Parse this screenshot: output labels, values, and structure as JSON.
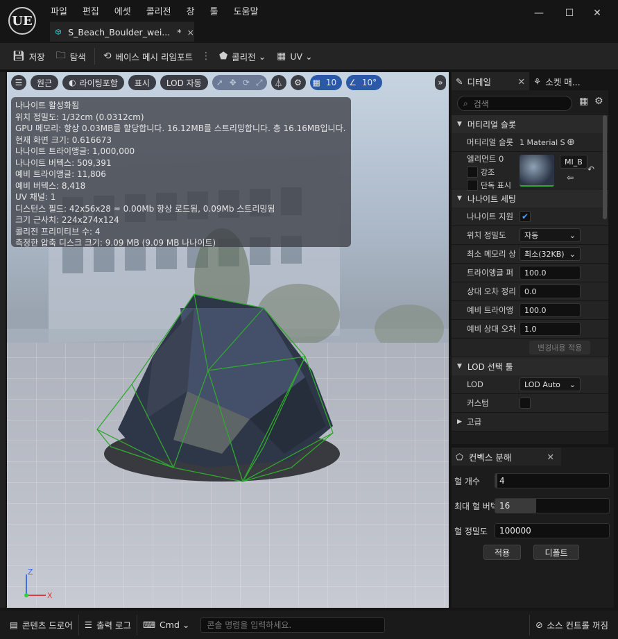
{
  "app": {
    "logo": "UE",
    "menu": [
      "파일",
      "편집",
      "에셋",
      "콜리전",
      "창",
      "툴",
      "도움말"
    ],
    "window_controls": [
      "minimize-icon",
      "maximize-icon",
      "close-icon"
    ]
  },
  "doc_tab": {
    "title": "S_Beach_Boulder_wei...",
    "dirty": "*",
    "close": "×"
  },
  "toolbar": {
    "save": "저장",
    "browse": "탐색",
    "reimport": "베이스 메시 리임포트",
    "collision": "콜리전",
    "uv": "UV"
  },
  "viewport": {
    "tools": {
      "perspective": "원근",
      "lighting": "라이팅포함",
      "show": "표시",
      "lod": "LOD 자동",
      "grid_snap": "10",
      "rot_snap": "10°"
    },
    "stats": [
      "나나이트 활성화됨",
      "위치 정밀도: 1/32cm (0.0312cm)",
      "GPU 메모리: 항상 0.03MB를 할당합니다. 16.12MB를 스트리밍합니다. 총 16.16MB입니다.",
      "현재 화면 크기: 0.616673",
      "나나이트 트라이앵글: 1,000,000",
      "나나이트 버텍스: 509,391",
      "예비 트라이앵글: 11,806",
      "예비 버텍스: 8,418",
      "UV 채널: 1",
      "디스턴스 필드: 42x56x28 = 0.00Mb 항상 로드됨, 0.09Mb 스트리밍됨",
      "크기 근사치: 224x274x124",
      "콜리전 프리미티브 수: 4",
      "측정한 압축 디스크 크기: 9.09 MB (9.09 MB 나나이트)"
    ],
    "gizmo": {
      "z": "Z",
      "x": "X"
    }
  },
  "details": {
    "tab_label": "디테일",
    "tab2_label": "소켓 매...",
    "search_placeholder": "검색",
    "material_section": "머티리얼 슬롯",
    "material_slots_label": "머티리얼 슬롯",
    "material_slots_value": "1 Material S",
    "element_label": "엘리먼트 0",
    "highlight_label": "강조",
    "isolate_label": "단독 표시",
    "material_name": "MI_B",
    "nanite_section": "나나이트 세팅",
    "rows": {
      "nanite_support": "나나이트 지원",
      "position_precision": "위치 정밀도",
      "position_precision_value": "자동",
      "min_memory": "최소 메모리 상",
      "min_memory_value": "최소(32KB)",
      "triangle_percent": "트라이앵글 퍼",
      "triangle_percent_value": "100.0",
      "relative_error": "상대 오차 정리",
      "relative_error_value": "0.0",
      "fallback_triangle": "예비 트라이앵",
      "fallback_triangle_value": "100.0",
      "fallback_relative": "예비 상대 오차",
      "fallback_relative_value": "1.0",
      "apply_changes": "변경내용 적용"
    },
    "lod_section": "LOD 선택 툴",
    "lod_label": "LOD",
    "lod_value": "LOD Auto",
    "custom_label": "커스텀",
    "advanced_label": "고급"
  },
  "convex": {
    "tab_label": "컨벡스 분해",
    "hull_count_label": "헐 개수",
    "hull_count_value": "4",
    "hull_count_fill": 0.02,
    "max_hull_label": "최대 헐 버텍",
    "max_hull_value": "16",
    "max_hull_fill": 0.36,
    "hull_precision_label": "헐 정밀도",
    "hull_precision_value": "100000",
    "apply": "적용",
    "default": "디폴트"
  },
  "statusbar": {
    "content_drawer": "콘텐츠 드로어",
    "output_log": "출력 로그",
    "cmd": "Cmd",
    "cmd_placeholder": "콘솔 명령을 입력하세요.",
    "source_control": "소스 컨트롤 꺼짐"
  },
  "colors": {
    "accent_blue": "#2b59a8",
    "collision_green": "#2fa82f",
    "panel_bg": "#242424"
  }
}
